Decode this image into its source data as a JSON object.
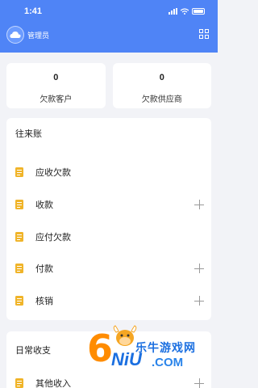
{
  "status_bar": {
    "time": "1:41"
  },
  "appbar": {
    "user_name": "管理员"
  },
  "stats": [
    {
      "value": "0",
      "label": "欠款客户"
    },
    {
      "value": "0",
      "label": "欠款供应商"
    }
  ],
  "accounts": {
    "title": "往来账",
    "items": [
      {
        "label": "应收欠款",
        "has_add": false
      },
      {
        "label": "收款",
        "has_add": true
      },
      {
        "label": "应付欠款",
        "has_add": false
      },
      {
        "label": "付款",
        "has_add": true
      },
      {
        "label": "核销",
        "has_add": true
      }
    ]
  },
  "daily": {
    "title": "日常收支",
    "items": [
      {
        "label": "其他收入",
        "has_add": true
      }
    ]
  },
  "watermark": {
    "brand_text": "乐牛游戏网",
    "digit": "6",
    "niu": "NiU",
    "com": ".COM"
  },
  "colors": {
    "header": "#4f84f6",
    "icon": "#f0b429",
    "background": "#f2f3f7"
  }
}
